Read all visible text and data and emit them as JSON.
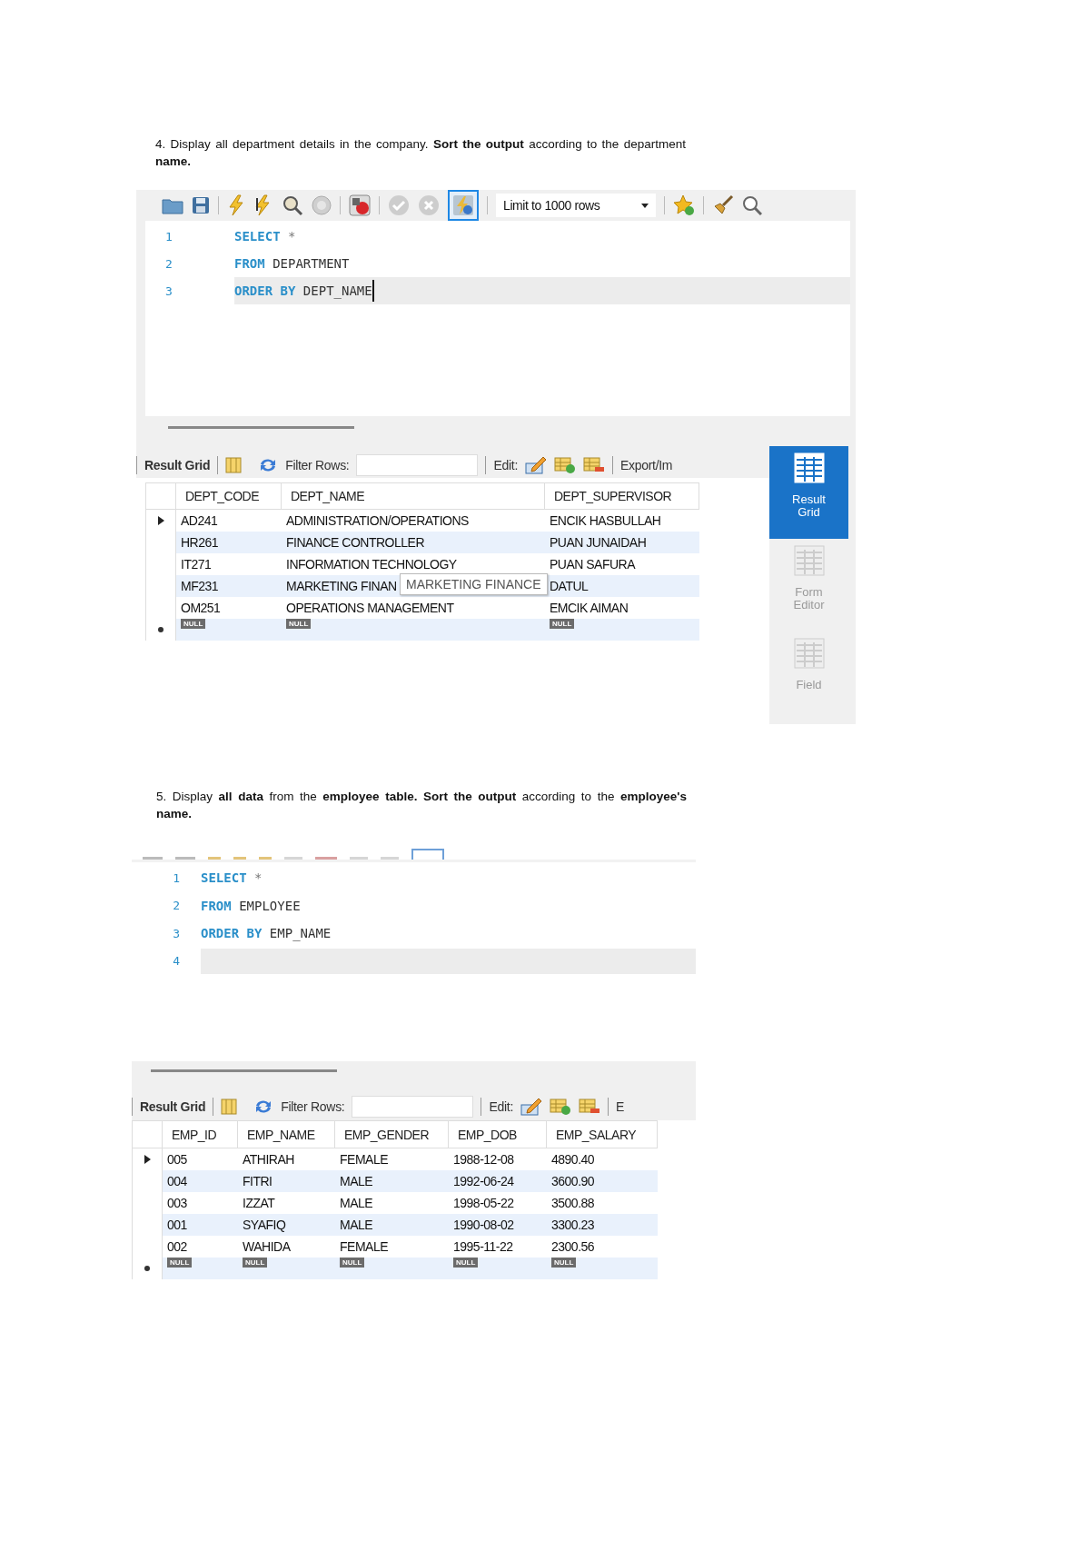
{
  "sections": [
    {
      "question": "4. Display all department details in the company. **Sort the output** according to the department **name.**",
      "toolbar": {
        "limit": "Limit to 1000 rows",
        "toggle_active": true
      },
      "editor": {
        "lines": [
          {
            "number": "1",
            "current": false,
            "cursor": false,
            "parts": [
              {
                "kind": "keyword",
                "text": "SELECT"
              },
              {
                "kind": "plain",
                "text": " *"
              }
            ]
          },
          {
            "number": "2",
            "current": false,
            "cursor": false,
            "parts": [
              {
                "kind": "keyword",
                "text": "FROM"
              },
              {
                "kind": "ident",
                "text": " DEPARTMENT"
              }
            ]
          },
          {
            "number": "3",
            "current": true,
            "cursor": true,
            "parts": [
              {
                "kind": "keyword",
                "text": "ORDER BY"
              },
              {
                "kind": "ident",
                "text": " DEPT_NAME"
              }
            ]
          }
        ]
      },
      "result_bar": {
        "tab": "Result Grid",
        "filter_label": "Filter Rows:",
        "edit_label": "Edit:",
        "export_label": "Export/Im"
      },
      "grid": {
        "columns": [
          "DEPT_CODE",
          "DEPT_NAME",
          "DEPT_SUPERVISOR"
        ],
        "rows": [
          {
            "kind": "current",
            "cells": [
              "AD241",
              "ADMINISTRATION/OPERATIONS",
              "ENCIK HASBULLAH"
            ]
          },
          {
            "kind": "data",
            "cells": [
              "HR261",
              "FINANCE CONTROLLER",
              "PUAN JUNAIDAH"
            ]
          },
          {
            "kind": "data",
            "cells": [
              "IT271",
              "INFORMATION TECHNOLOGY",
              "PUAN SAFURA"
            ]
          },
          {
            "kind": "data",
            "cells": [
              "MF231",
              "MARKETING FINAN",
              "DATUL"
            ]
          },
          {
            "kind": "data",
            "cells": [
              "OM251",
              "OPERATIONS MANAGEMENT",
              "EMCIK AIMAN"
            ]
          },
          {
            "kind": "new",
            "cells": [
              "NULL",
              "NULL",
              "NULL"
            ]
          }
        ],
        "tooltip": "MARKETING FINANCE"
      },
      "side_panel": [
        {
          "label": "Result Grid",
          "selected": true
        },
        {
          "label": "Form Editor",
          "selected": false
        },
        {
          "label": "Field",
          "selected": false
        }
      ]
    },
    {
      "question": "5. Display **all data** from the **employee table. Sort the output** according to the **employee's name.**",
      "editor": {
        "lines": [
          {
            "number": "1",
            "current": false,
            "cursor": false,
            "parts": [
              {
                "kind": "keyword",
                "text": "SELECT"
              },
              {
                "kind": "plain",
                "text": " *"
              }
            ]
          },
          {
            "number": "2",
            "current": false,
            "cursor": false,
            "parts": [
              {
                "kind": "keyword",
                "text": "FROM"
              },
              {
                "kind": "ident",
                "text": " EMPLOYEE"
              }
            ]
          },
          {
            "number": "3",
            "current": false,
            "cursor": false,
            "parts": [
              {
                "kind": "keyword",
                "text": "ORDER BY"
              },
              {
                "kind": "ident",
                "text": " EMP_NAME"
              }
            ]
          },
          {
            "number": "4",
            "current": true,
            "cursor": false
          }
        ]
      },
      "result_bar": {
        "tab": "Result Grid",
        "filter_label": "Filter Rows:",
        "edit_label": "Edit:",
        "export_label": "E"
      },
      "grid": {
        "columns": [
          "EMP_ID",
          "EMP_NAME",
          "EMP_GENDER",
          "EMP_DOB",
          "EMP_SALARY"
        ],
        "rows": [
          {
            "kind": "current",
            "cells": [
              "005",
              "ATHIRAH",
              "FEMALE",
              "1988-12-08",
              "4890.40"
            ]
          },
          {
            "kind": "data",
            "cells": [
              "004",
              "FITRI",
              "MALE",
              "1992-06-24",
              "3600.90"
            ]
          },
          {
            "kind": "data",
            "cells": [
              "003",
              "IZZAT",
              "MALE",
              "1998-05-22",
              "3500.88"
            ]
          },
          {
            "kind": "data",
            "cells": [
              "001",
              "SYAFIQ",
              "MALE",
              "1990-08-02",
              "3300.23"
            ]
          },
          {
            "kind": "data",
            "cells": [
              "002",
              "WAHIDA",
              "FEMALE",
              "1995-11-22",
              "2300.56"
            ]
          },
          {
            "kind": "new",
            "cells": [
              "NULL",
              "NULL",
              "NULL",
              "NULL",
              "NULL"
            ]
          }
        ]
      }
    }
  ]
}
